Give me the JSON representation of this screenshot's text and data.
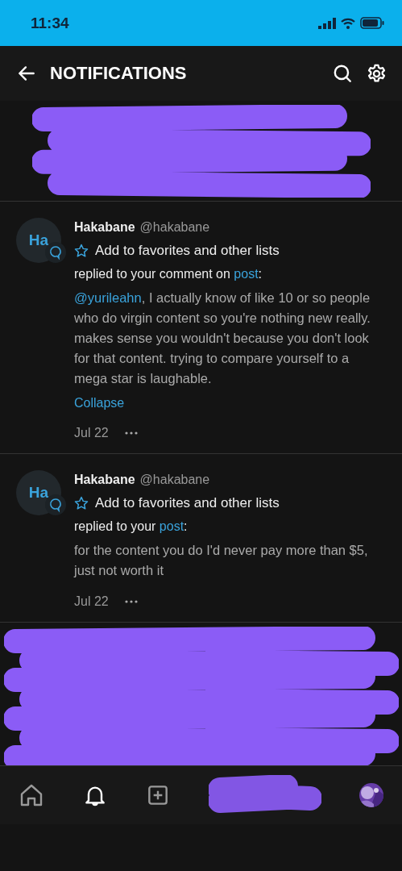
{
  "status_bar": {
    "time": "11:34"
  },
  "header": {
    "title": "NOTIFICATIONS"
  },
  "notifications": [
    {
      "kind": "redacted"
    },
    {
      "kind": "reply",
      "avatar_initials": "Ha",
      "name": "Hakabane",
      "handle": "@hakabane",
      "favorite_label": "Add to favorites and other lists",
      "action": "replied to your comment on ",
      "link": "post",
      "action_end": ":",
      "mention": "@yurileahn",
      "message": ", I actually know of like 10 or so people who do virgin content so you're nothing new really. makes sense you wouldn't because you don't look for that content. trying to compare yourself to a mega star is laughable.",
      "toggle": "Collapse",
      "date": "Jul 22"
    },
    {
      "kind": "reply",
      "avatar_initials": "Ha",
      "name": "Hakabane",
      "handle": "@hakabane",
      "favorite_label": "Add to favorites and other lists",
      "action": "replied to your ",
      "link": "post",
      "action_end": ":",
      "message": "for the content you do I'd never pay more than $5, just not worth it",
      "date": "Jul 22"
    },
    {
      "kind": "redacted"
    }
  ],
  "bottom_nav": [
    {
      "kind": "home",
      "selected": false
    },
    {
      "kind": "bell",
      "selected": true
    },
    {
      "kind": "add",
      "selected": false
    },
    {
      "kind": "redacted",
      "selected": false
    },
    {
      "kind": "avatar",
      "selected": false
    }
  ]
}
